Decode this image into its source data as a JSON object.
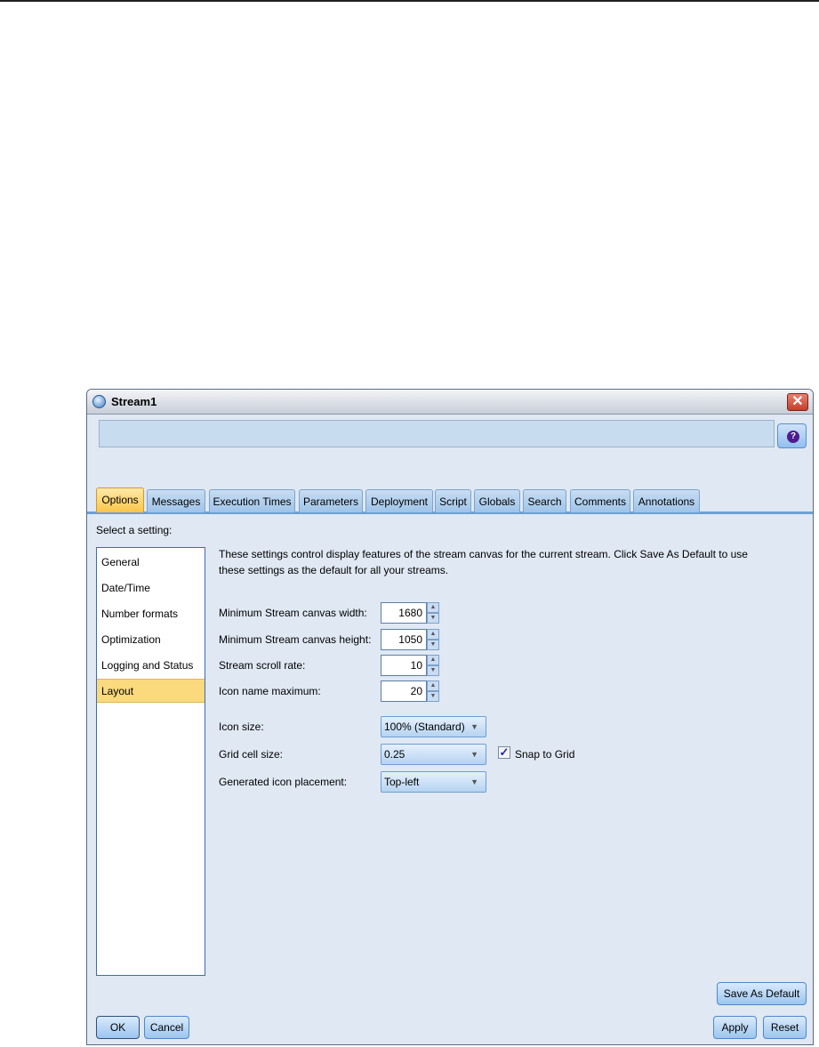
{
  "window": {
    "title": "Stream1",
    "close_icon": "close-icon",
    "help_icon": "help-icon"
  },
  "tabs": [
    "Options",
    "Messages",
    "Execution Times",
    "Parameters",
    "Deployment",
    "Script",
    "Globals",
    "Search",
    "Comments",
    "Annotations"
  ],
  "active_tab": "Options",
  "select_label": "Select a setting:",
  "settings_list": [
    "General",
    "Date/Time",
    "Number formats",
    "Optimization",
    "Logging and Status",
    "Layout"
  ],
  "selected_setting": "Layout",
  "description_line1": "These settings control display features of the stream canvas for the current stream. Click Save As Default to use",
  "description_line2": "these settings as the default for all your streams.",
  "fields": {
    "min_width": {
      "label": "Minimum Stream canvas width:",
      "value": "1680"
    },
    "min_height": {
      "label": "Minimum Stream canvas height:",
      "value": "1050"
    },
    "scroll_rate": {
      "label": "Stream scroll rate:",
      "value": "10"
    },
    "icon_name_max": {
      "label": "Icon name maximum:",
      "value": "20"
    },
    "icon_size": {
      "label": "Icon size:",
      "value": "100% (Standard)"
    },
    "grid_cell_size": {
      "label": "Grid cell size:",
      "value": "0.25"
    },
    "snap_to_grid": {
      "label": "Snap to Grid",
      "checked": true
    },
    "icon_placement": {
      "label": "Generated icon placement:",
      "value": "Top-left"
    }
  },
  "buttons": {
    "save_default": "Save As Default",
    "ok": "OK",
    "cancel": "Cancel",
    "apply": "Apply",
    "reset": "Reset"
  }
}
